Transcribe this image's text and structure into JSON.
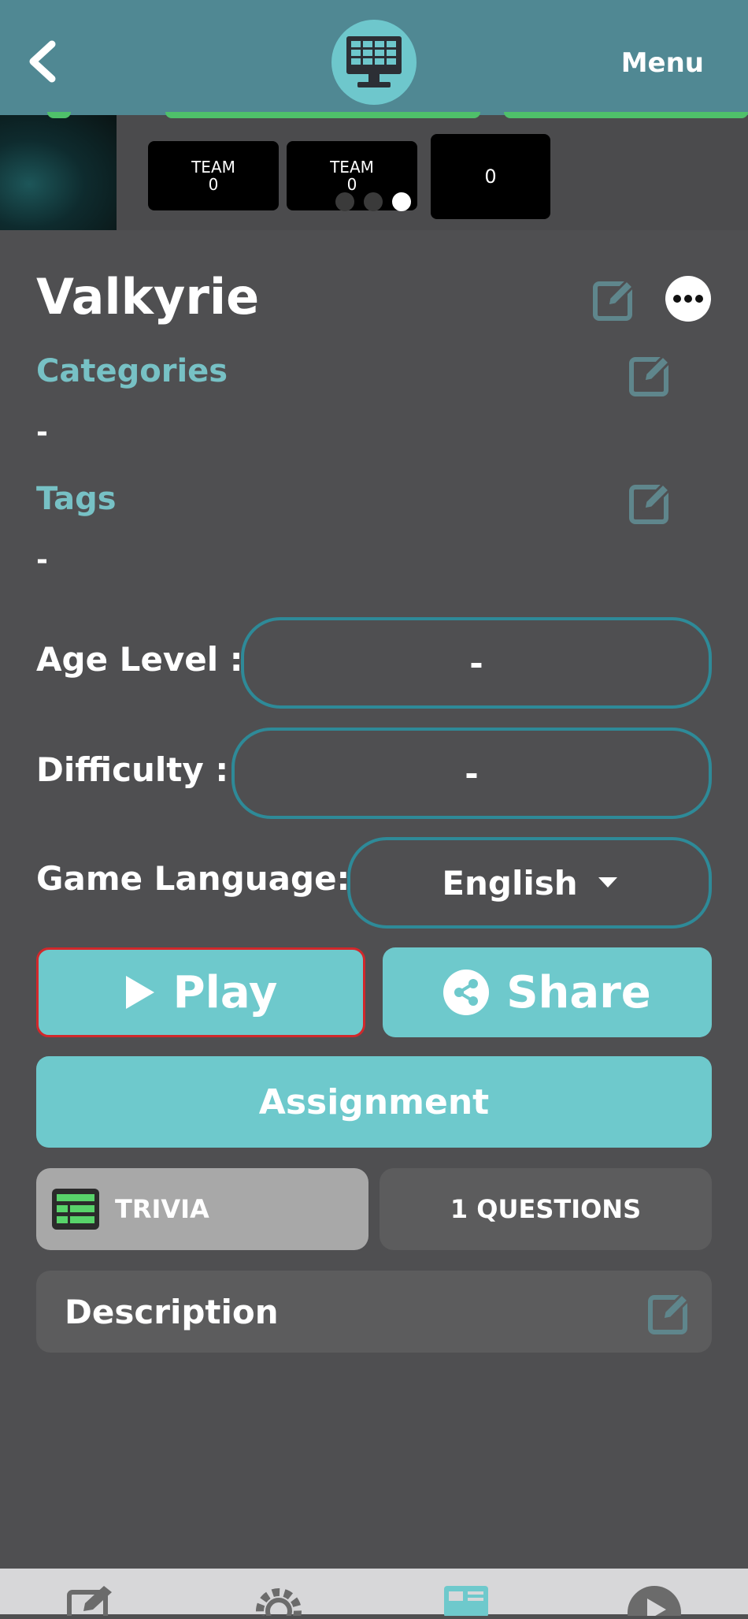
{
  "header": {
    "back_icon": "chevron-left-icon",
    "logo_icon": "scoreboard-monitor-icon",
    "menu_label": "Menu"
  },
  "preview": {
    "team1_label": "TEAM",
    "team1_score": "0",
    "team2_label": "TEAM",
    "team2_score": "0",
    "score3": "0",
    "carousel_active_index": 2,
    "carousel_count": 3
  },
  "game": {
    "title": "Valkyrie",
    "categories_label": "Categories",
    "categories_value": "-",
    "tags_label": "Tags",
    "tags_value": "-",
    "age_level_label": "Age Level :",
    "age_level_value": "-",
    "difficulty_label": "Difficulty :",
    "difficulty_value": "-",
    "language_label": "Game Language:",
    "language_value": "English"
  },
  "actions": {
    "play_label": "Play",
    "share_label": "Share",
    "assignment_label": "Assignment"
  },
  "info": {
    "type_label": "TRIVIA",
    "questions_label": "1 QUESTIONS",
    "description_label": "Description"
  },
  "colors": {
    "header_bg": "#508893",
    "accent": "#6ec9cc",
    "section_label": "#77c1c5",
    "page_bg": "#4f4f51",
    "highlight_border": "#d2282b"
  }
}
